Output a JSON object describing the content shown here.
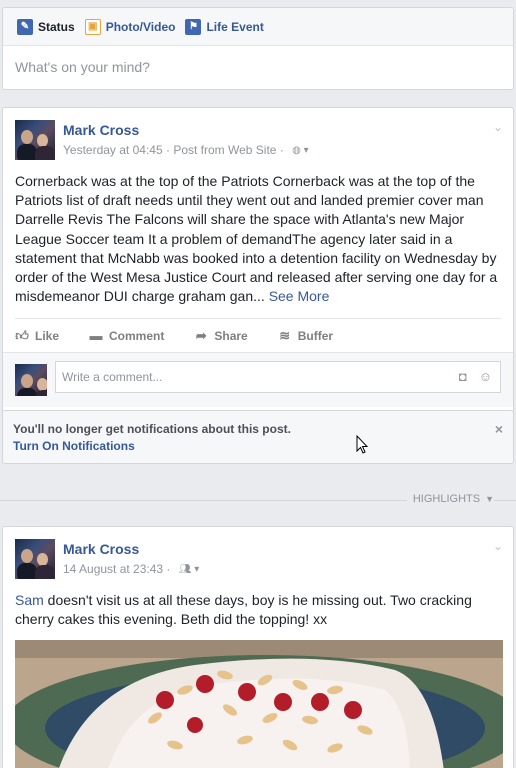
{
  "composer": {
    "tabs": [
      {
        "label": "Status",
        "icon": "pencil-icon"
      },
      {
        "label": "Photo/Video",
        "icon": "photo-icon"
      },
      {
        "label": "Life Event",
        "icon": "flag-icon"
      }
    ],
    "placeholder": "What's on your mind?"
  },
  "post1": {
    "author": "Mark Cross",
    "timestamp": "Yesterday at 04:45",
    "source": "Post from Web Site",
    "privacy_icon": "globe-icon",
    "text": "Cornerback was at the top of the Patriots Cornerback was at the top of the Patriots list of draft needs until they went out and landed premier cover man Darrelle Revis The Falcons will share the space with Atlanta's new Major League Soccer team It a problem of demandThe agency later said in a statement that McNabb was booked into a detention facility on Wednesday by order of the West Mesa Justice Court and released after serving one day for a misdemeanor DUI charge graham gan...",
    "see_more": "See More",
    "actions": [
      {
        "label": "Like",
        "icon": "thumbs-up-icon"
      },
      {
        "label": "Comment",
        "icon": "comment-icon"
      },
      {
        "label": "Share",
        "icon": "share-icon"
      },
      {
        "label": "Buffer",
        "icon": "buffer-icon"
      }
    ],
    "comment_placeholder": "Write a comment..."
  },
  "notification": {
    "message": "You'll no longer get notifications about this post.",
    "link": "Turn On Notifications"
  },
  "highlights_label": "HIGHLIGHTS",
  "post2": {
    "author": "Mark Cross",
    "timestamp": "14 August at 23:43",
    "privacy_icon": "friends-icon",
    "mention": "Sam",
    "text": " doesn't visit us at all these days, boy is he missing out. Two cracking cherry cakes this evening. Beth did the topping! xx"
  },
  "colors": {
    "link": "#365899",
    "background": "#e9ebee",
    "muted": "#90949c"
  }
}
